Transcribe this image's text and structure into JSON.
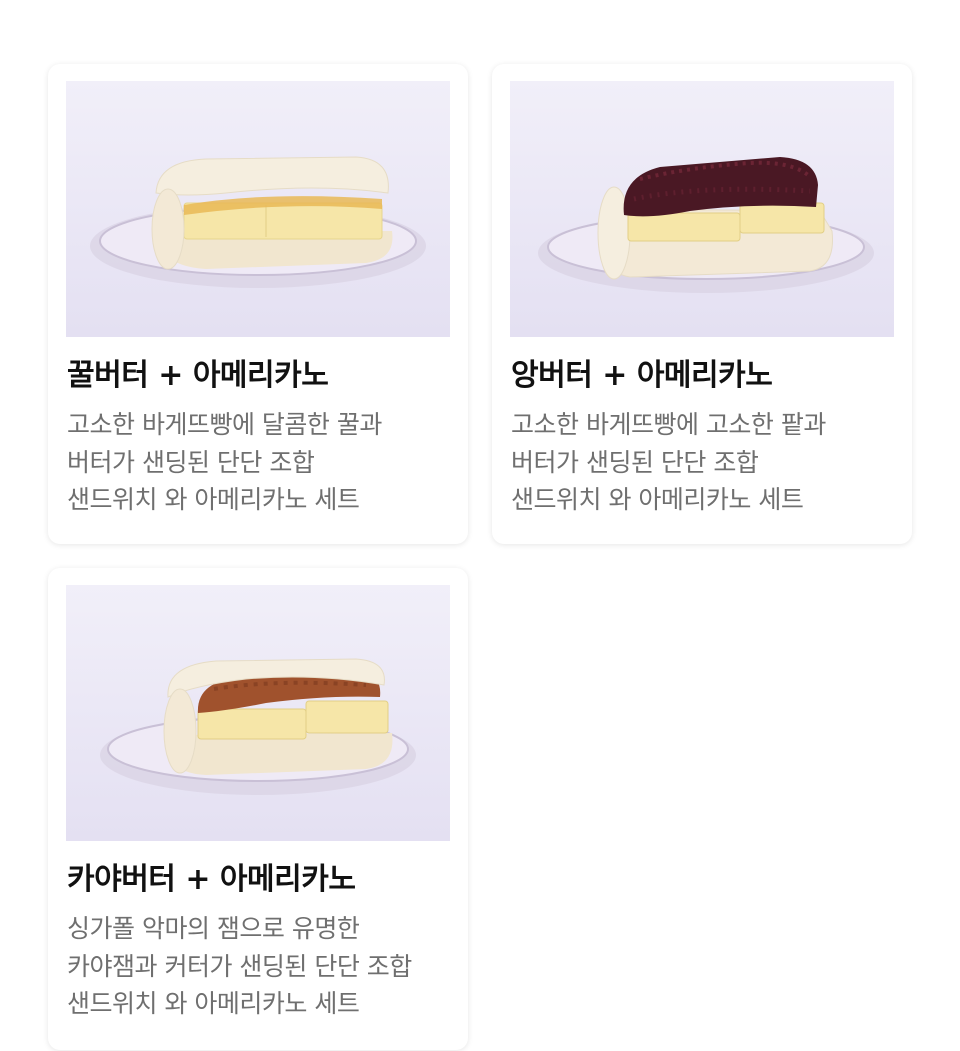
{
  "products": [
    {
      "title": "꿀버터 + 아메리카노",
      "description": [
        "고소한 바게뜨빵에 달콤한 꿀과",
        "버터가 샌딩된 단단 조합",
        "샌드위치 와 아메리카노 세트"
      ],
      "image": {
        "subject": "honey butter sandwich on a glass plate",
        "filling_color": "#f3dc9c",
        "bread_color": "#f2e8d4"
      }
    },
    {
      "title": "앙버터 + 아메리카노",
      "description": [
        "고소한 바게뜨빵에 고소한 팥과",
        "버터가 샌딩된 단단 조합",
        "샌드위치 와 아메리카노 세트"
      ],
      "image": {
        "subject": "red bean butter sandwich on a glass plate",
        "filling_color": "#4a1824",
        "bread_color": "#f2e8d4"
      }
    },
    {
      "title": "카야버터 + 아메리카노",
      "description": [
        "싱가폴 악마의 잼으로 유명한",
        "카야잼과 커터가 샌딩된 단단 조합",
        "샌드위치 와 아메리카노 세트"
      ],
      "image": {
        "subject": "kaya butter sandwich on a glass plate",
        "filling_color": "#a0522d",
        "bread_color": "#f2e8d4"
      }
    }
  ],
  "colors": {
    "title": "#111111",
    "description": "#6f6f6f",
    "photo_background": "#ebe8f6",
    "butter": "#f6e6a8"
  }
}
